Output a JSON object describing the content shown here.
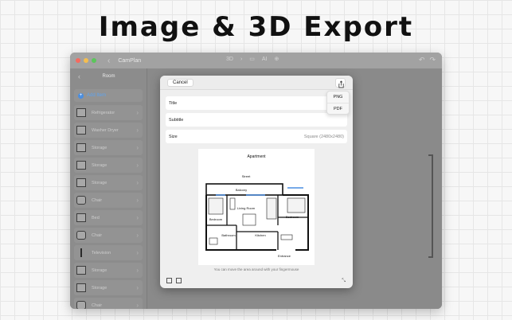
{
  "headline": "Image & 3D Export",
  "window": {
    "app_title": "CamPlan",
    "back_glyph": "‹",
    "traffic_lights": [
      "#f56a5f",
      "#f5be4f",
      "#5bc65b"
    ],
    "toolbar_center": {
      "mode_label": "3D",
      "ai_label": "AI"
    },
    "toolbar_right": {
      "undo_glyph": "↶",
      "redo_glyph": "↷"
    }
  },
  "sidebar": {
    "back_glyph": "‹",
    "title": "Room",
    "add_item_label": "Add Item",
    "items": [
      {
        "label": "Refrigerator",
        "icon": "refrigerator-icon"
      },
      {
        "label": "Washer Dryer",
        "icon": "washer-dryer-icon"
      },
      {
        "label": "Storage",
        "icon": "storage-icon"
      },
      {
        "label": "Storage",
        "icon": "storage-icon"
      },
      {
        "label": "Storage",
        "icon": "storage-icon"
      },
      {
        "label": "Chair",
        "icon": "chair-icon"
      },
      {
        "label": "Bed",
        "icon": "bed-icon"
      },
      {
        "label": "Chair",
        "icon": "chair-icon"
      },
      {
        "label": "Television",
        "icon": "television-icon"
      },
      {
        "label": "Storage",
        "icon": "storage-icon"
      },
      {
        "label": "Storage",
        "icon": "storage-icon"
      },
      {
        "label": "Chair",
        "icon": "chair-icon"
      }
    ]
  },
  "export_dialog": {
    "cancel_label": "Cancel",
    "fields": {
      "title_label": "Title",
      "subtitle_label": "Subtitle",
      "size_label": "Size",
      "size_value": "Square (2480x2480)"
    },
    "format_menu": [
      "PNG",
      "PDF"
    ],
    "preview": {
      "plan_title": "Apartment",
      "labels": {
        "street": "Street",
        "balcony": "Balcony",
        "living_room": "Living Room",
        "bedroom_left": "Bedroom",
        "bedroom_right": "Bedroom",
        "bathroom": "Bathroom",
        "kitchen": "Kitchen",
        "entrance": "Entrance"
      }
    },
    "hint": "You can move the area around with your fingermouse"
  }
}
